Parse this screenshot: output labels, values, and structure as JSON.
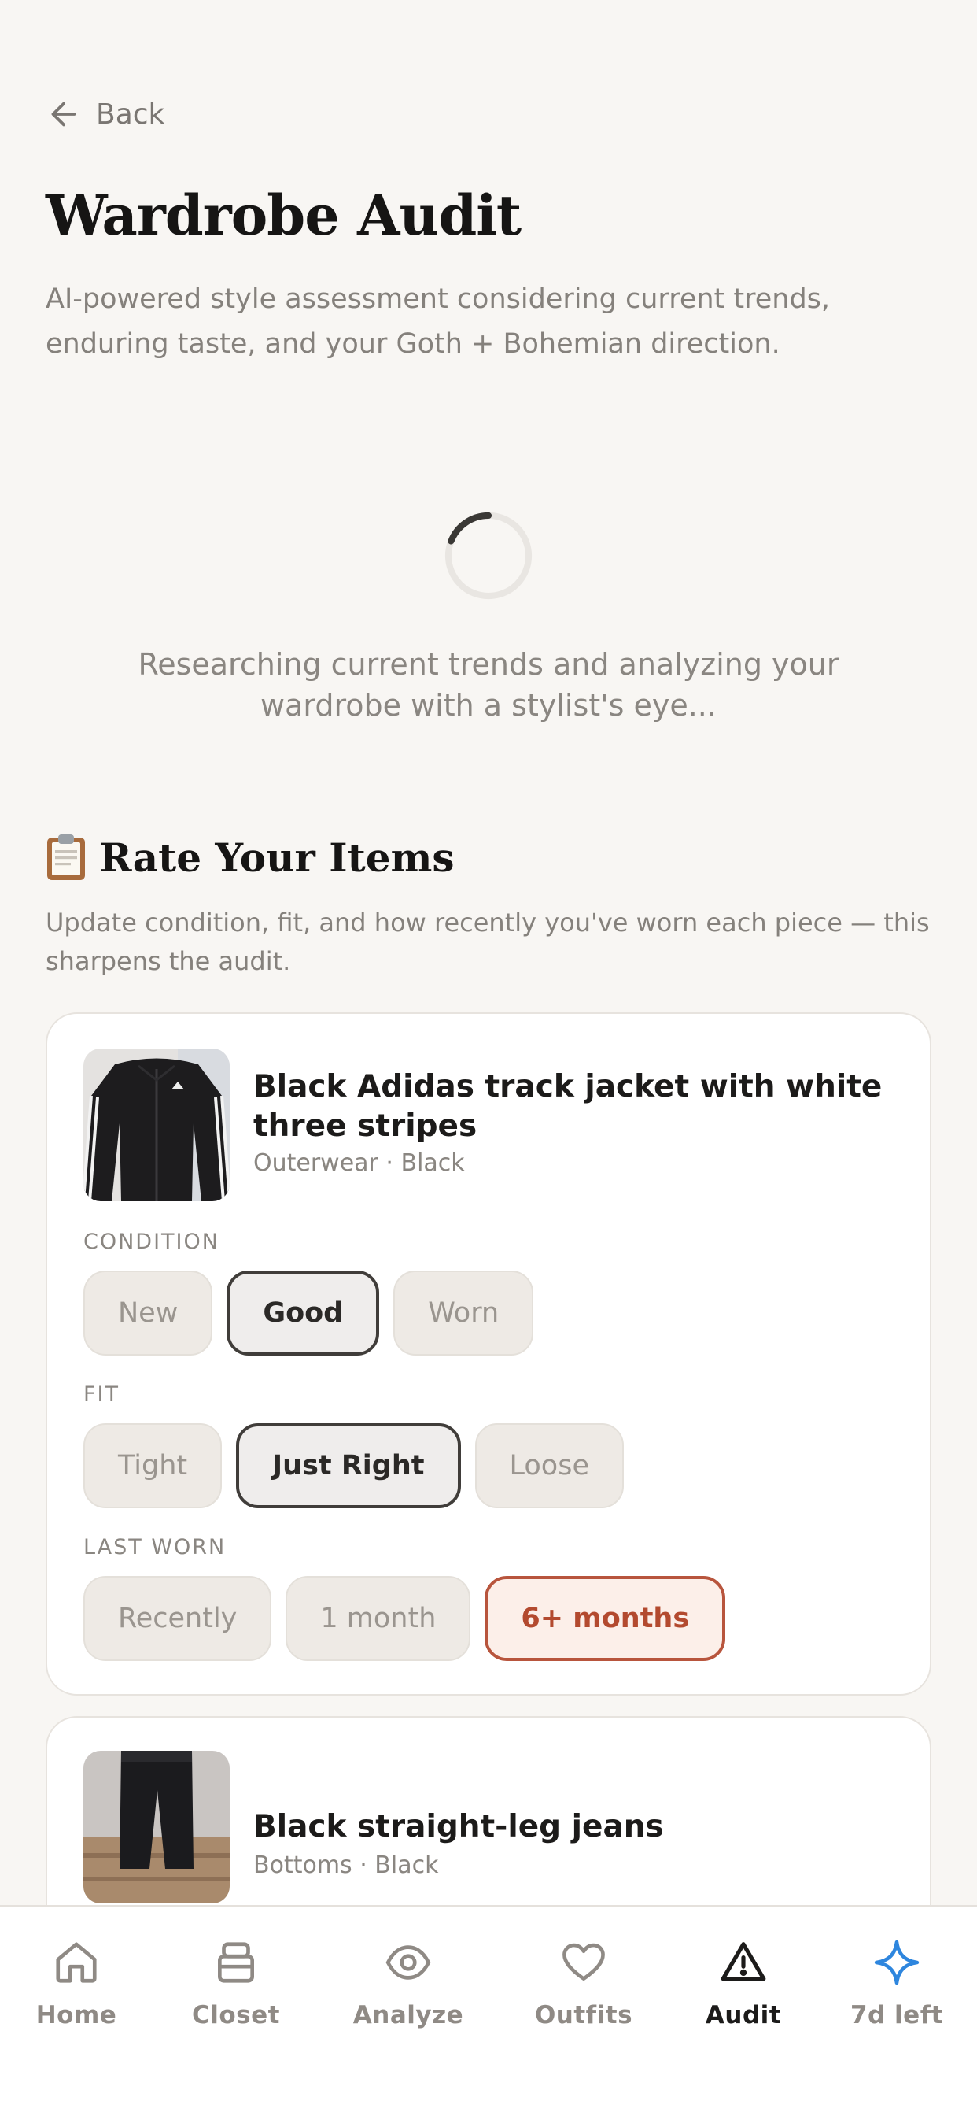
{
  "header": {
    "back_label": "Back",
    "title": "Wardrobe Audit",
    "subtitle": "AI-powered style assessment considering current trends, enduring taste, and your Goth + Bohemian direction."
  },
  "loading": {
    "message": "Researching current trends and analyzing your wardrobe with a stylist's eye..."
  },
  "rate_section": {
    "emoji": "📋",
    "title": "Rate Your Items",
    "description": "Update condition, fit, and how recently you've worn each piece — this sharpens the audit."
  },
  "items": [
    {
      "name": "Black Adidas track jacket with white three stripes",
      "meta": "Outerwear · Black",
      "condition_label": "CONDITION",
      "condition_options": [
        "New",
        "Good",
        "Worn"
      ],
      "condition_selected": "Good",
      "fit_label": "FIT",
      "fit_options": [
        "Tight",
        "Just Right",
        "Loose"
      ],
      "fit_selected": "Just Right",
      "last_worn_label": "LAST WORN",
      "last_worn_options": [
        "Recently",
        "1 month",
        "6+ months"
      ],
      "last_worn_selected": "6+ months"
    },
    {
      "name": "Black straight-leg jeans",
      "meta": "Bottoms · Black"
    }
  ],
  "nav": {
    "items": [
      {
        "label": "Home",
        "icon": "home-icon"
      },
      {
        "label": "Closet",
        "icon": "closet-icon"
      },
      {
        "label": "Analyze",
        "icon": "eye-icon"
      },
      {
        "label": "Outfits",
        "icon": "heart-icon"
      },
      {
        "label": "Audit",
        "icon": "warning-icon"
      },
      {
        "label": "7d left",
        "icon": "sparkle-icon"
      }
    ],
    "active": "Audit"
  },
  "colors": {
    "background": "#f8f6f3",
    "warn_accent": "#b8553d",
    "selected_border": "#403d3a",
    "sparkle_blue": "#2e86de"
  }
}
